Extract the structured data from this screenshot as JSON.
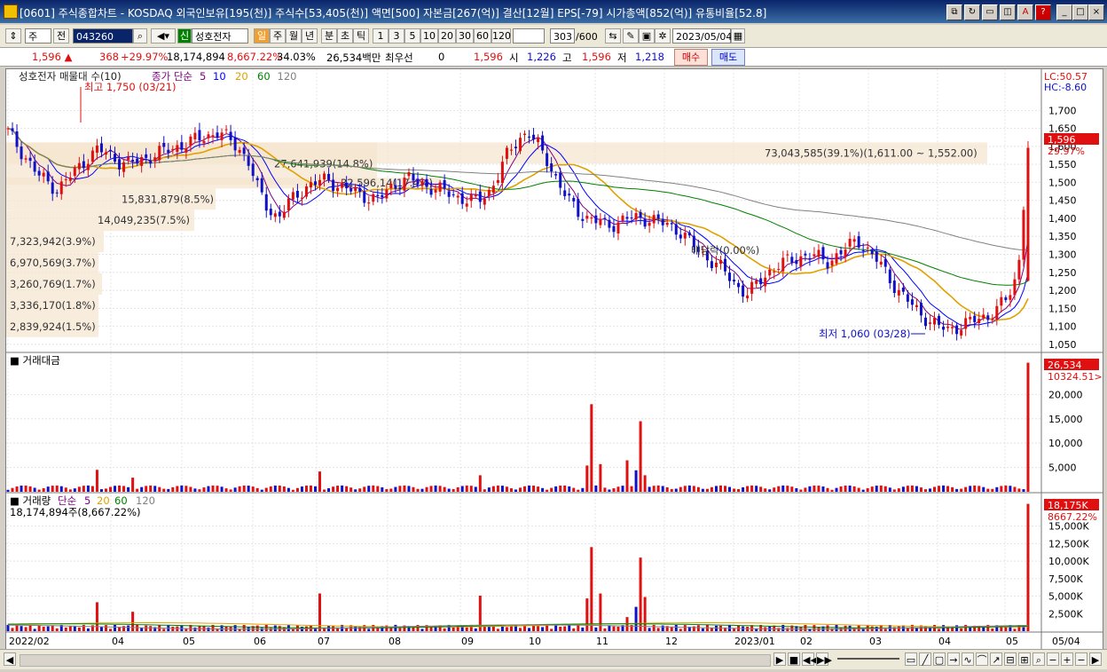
{
  "window": {
    "title": "[0601] 주식종합차트 - KOSDAQ 외국인보유[195(천)] 주식수[53,405(천)] 액면[500] 자본금[267(억)] 결산[12월] EPS[-79] 시가총액[852(억)] 유통비율[52.8]"
  },
  "toolbar": {
    "unit": "주",
    "prev_label": "전",
    "code": "043260",
    "badge": "신",
    "stock_name": "성호전자",
    "periods": [
      "일",
      "주",
      "월",
      "년",
      "분",
      "초",
      "틱"
    ],
    "intervals": [
      "1",
      "3",
      "5",
      "10",
      "20",
      "30",
      "60",
      "120"
    ],
    "count": "303",
    "count_max": "/600",
    "date": "2023/05/04"
  },
  "quote": {
    "price": "1,596",
    "change": "368",
    "change_pct": "+29.97%",
    "volume": "18,174,894",
    "volume_ratio": "8,667.22%",
    "turnover": "34.03%",
    "amount": "26,534백만",
    "best_label": "최우선",
    "best_value": "0",
    "best_price": "1,596",
    "open_label": "시",
    "open": "1,226",
    "high_label": "고",
    "high": "1,596",
    "low_label": "저",
    "low": "1,218",
    "buy_label": "매수",
    "sell_label": "매도"
  },
  "panels": {
    "price": {
      "title": "성호전자 매물대 수(10)",
      "ma_title": "종가 단순",
      "ma_periods": [
        "5",
        "10",
        "20",
        "60",
        "120"
      ],
      "high_note": "최고 1,750 (03/21)",
      "low_note": "최저 1,060 (03/28)",
      "ex_note": "배당락(0.00%)",
      "lc": "LC:50.57",
      "hc": "HC:-8.60",
      "last_price": "1,596",
      "last_pct": "29.97%"
    },
    "amount": {
      "title": "거래대금",
      "last": "26,534",
      "last2": "10324.51>"
    },
    "volume": {
      "title": "거래량",
      "ma_title": "단순",
      "ma_periods": [
        "5",
        "20",
        "60",
        "120"
      ],
      "subtitle": "18,174,894주(8,667.22%)",
      "last": "18,175K",
      "last2": "8667.22%"
    }
  },
  "chart_data": [
    {
      "type": "candlestick",
      "title": "성호전자 매물대 수(10)",
      "y_ticks": [
        "1,700",
        "1,650",
        "1,600",
        "1,550",
        "1,500",
        "1,450",
        "1,400",
        "1,350",
        "1,300",
        "1,250",
        "1,200",
        "1,150",
        "1,100",
        "1,050"
      ],
      "ylim": [
        1030,
        1760
      ],
      "x_ticks": [
        "2022/02",
        "04",
        "05",
        "06",
        "07",
        "08",
        "09",
        "10",
        "11",
        "12",
        "2023/01",
        "02",
        "03",
        "04",
        "05",
        "05/04"
      ],
      "volume_profile": [
        {
          "label": "73,043,585(39.1%)(1,611.00 ~ 1,552.00)",
          "low": 1552,
          "high": 1611
        },
        {
          "label": "27,641,939(14.8%)",
          "low": 1493,
          "high": 1611
        },
        {
          "label": "32,596,14(17.4%)",
          "low": 1483,
          "high": 1513
        },
        {
          "label": "15,831,879(8.5%)",
          "low": 1424,
          "high": 1483
        },
        {
          "label": "14,049,235(7.5%)",
          "low": 1365,
          "high": 1424
        },
        {
          "label": "7,323,942(3.9%)",
          "low": 1306,
          "high": 1365
        },
        {
          "label": "6,970,569(3.7%)",
          "low": 1247,
          "high": 1306
        },
        {
          "label": "3,260,769(1.7%)",
          "low": 1188,
          "high": 1247
        },
        {
          "label": "3,336,170(1.8%)",
          "low": 1129,
          "high": 1188
        },
        {
          "label": "2,839,924(1.5%)",
          "low": 1070,
          "high": 1129
        }
      ],
      "close_series": [
        1640,
        1600,
        1560,
        1520,
        1500,
        1480,
        1510,
        1540,
        1570,
        1590,
        1580,
        1560,
        1550,
        1560,
        1570,
        1580,
        1590,
        1600,
        1610,
        1620,
        1630,
        1640,
        1620,
        1600,
        1560,
        1480,
        1430,
        1400,
        1440,
        1470,
        1490,
        1500,
        1510,
        1490,
        1480,
        1470,
        1460,
        1450,
        1480,
        1500,
        1510,
        1500,
        1490,
        1480,
        1470,
        1460,
        1450,
        1450,
        1470,
        1520,
        1580,
        1620,
        1640,
        1600,
        1560,
        1500,
        1450,
        1420,
        1400,
        1390,
        1380,
        1390,
        1400,
        1400,
        1400,
        1390,
        1380,
        1370,
        1340,
        1310,
        1290,
        1270,
        1240,
        1210,
        1190,
        1220,
        1250,
        1270,
        1280,
        1290,
        1300,
        1290,
        1280,
        1300,
        1320,
        1340,
        1310,
        1280,
        1240,
        1200,
        1170,
        1140,
        1120,
        1100,
        1090,
        1100,
        1110,
        1120,
        1130,
        1150,
        1180,
        1250,
        1596
      ]
    },
    {
      "type": "bar",
      "title": "거래대금",
      "y_ticks": [
        "20,000",
        "15,000",
        "10,000",
        "5,000"
      ],
      "ylim": [
        0,
        27000
      ],
      "last_value": 26534
    },
    {
      "type": "bar",
      "title": "거래량",
      "y_ticks": [
        "15,000K",
        "12,500K",
        "10,000K",
        "7,500K",
        "5,000K",
        "2,500K"
      ],
      "ylim": [
        0,
        18500
      ],
      "last_value": 18175
    }
  ],
  "colors": {
    "up": "#e01010",
    "down": "#1010c8",
    "ma5": "#800080",
    "ma10": "#0000ff",
    "ma20": "#e0a000",
    "ma60": "#008000",
    "ma120": "#808080",
    "profile": "#f5e6d0"
  }
}
